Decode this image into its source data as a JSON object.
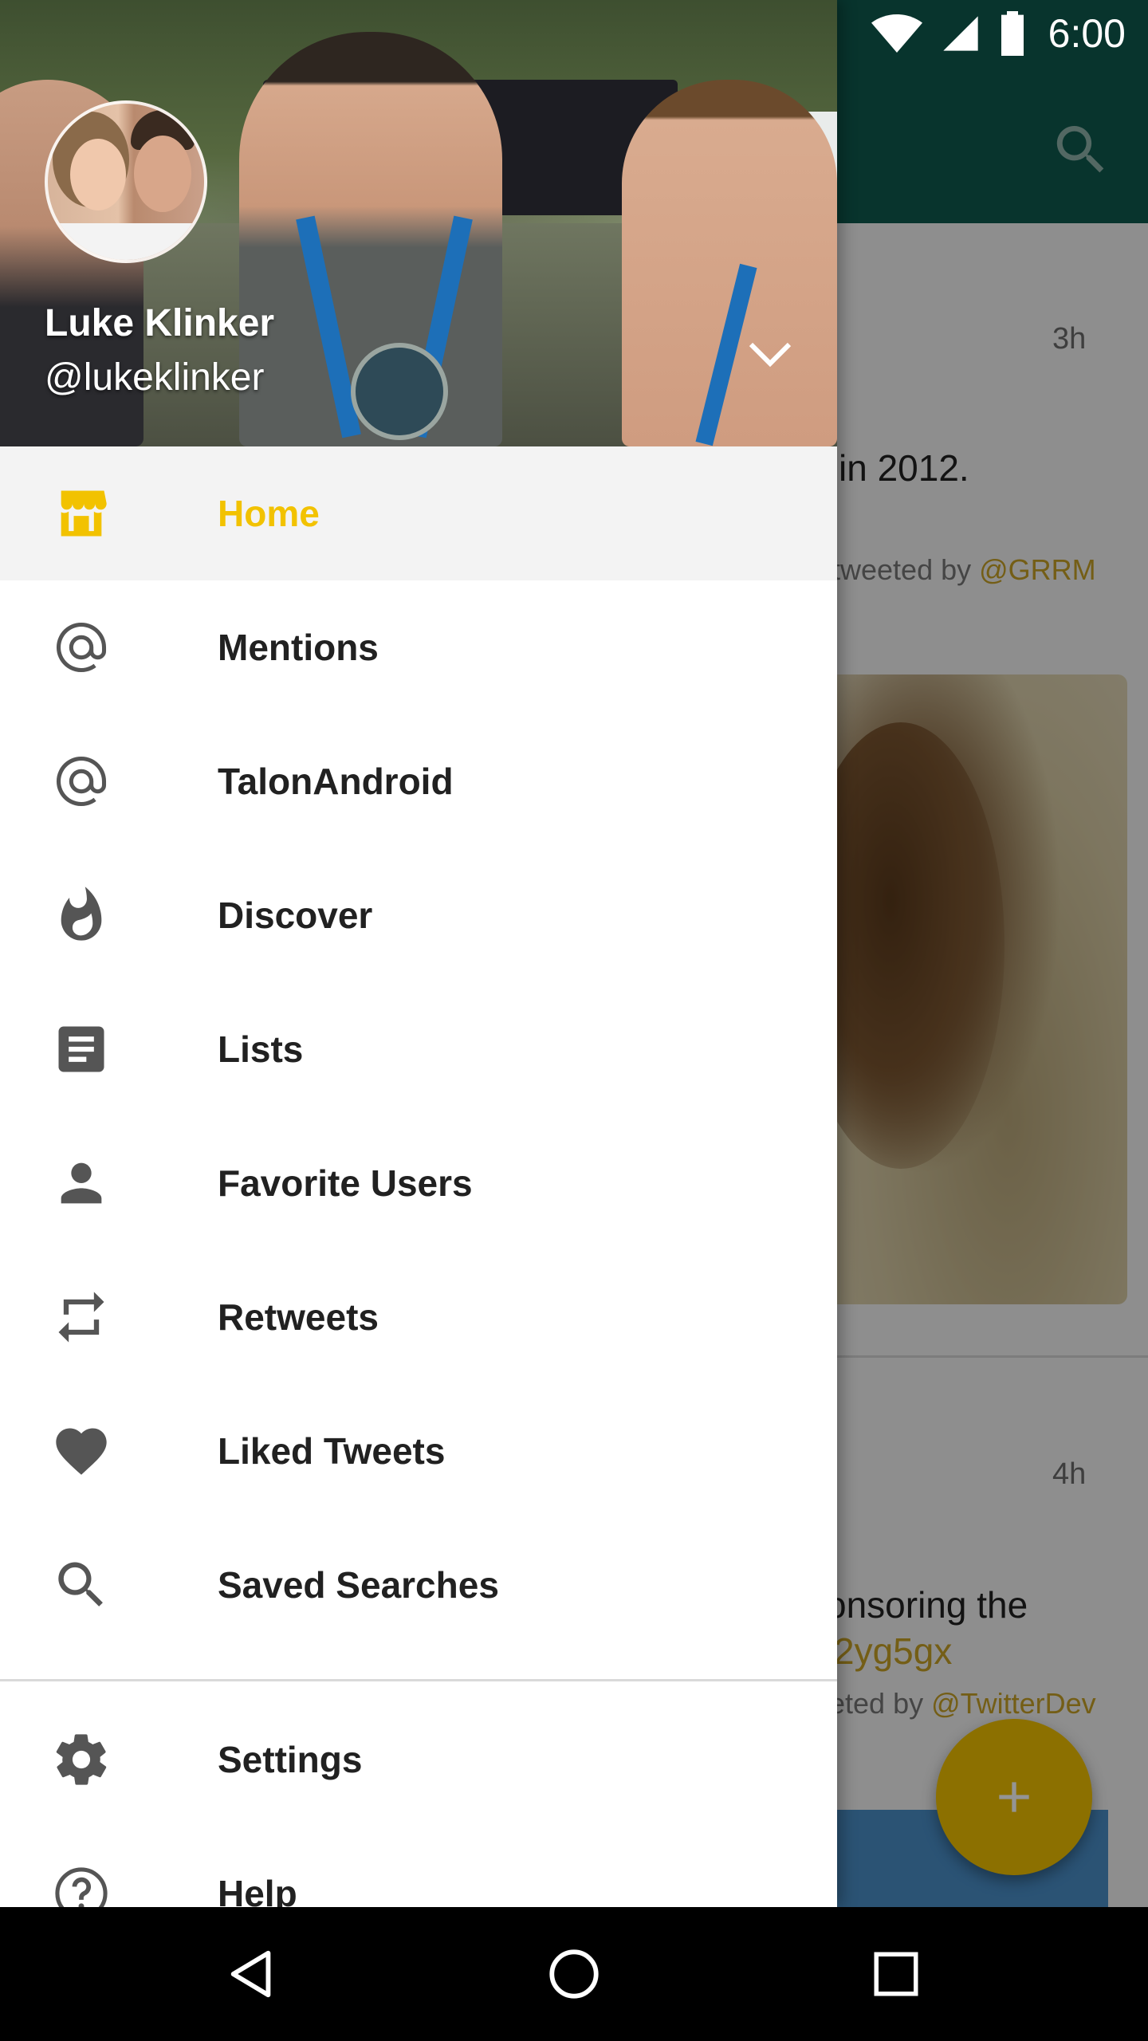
{
  "status_bar": {
    "time": "6:00"
  },
  "app_bar": {
    "search_icon": "search-icon"
  },
  "feed": {
    "tweets": [
      {
        "time": "3h",
        "text": "in 2012.",
        "retweet_prefix": "tweeted by ",
        "retweet_handle": "@GRRM"
      },
      {
        "time": "4h",
        "text_line1": "onsoring the",
        "text_line2": "2yg5gx",
        "retweet_prefix": "eted by ",
        "retweet_handle": "@TwitterDev"
      }
    ],
    "fab_icon": "plus-icon"
  },
  "drawer": {
    "profile": {
      "name": "Luke Klinker",
      "handle": "@lukeklinker",
      "chevron_icon": "chevron-down-icon"
    },
    "items": [
      {
        "label": "Home",
        "icon": "home-icon",
        "active": true
      },
      {
        "label": "Mentions",
        "icon": "at-icon"
      },
      {
        "label": "TalonAndroid",
        "icon": "at-icon"
      },
      {
        "label": "Discover",
        "icon": "flame-icon"
      },
      {
        "label": "Lists",
        "icon": "list-icon"
      },
      {
        "label": "Favorite Users",
        "icon": "person-icon"
      },
      {
        "label": "Retweets",
        "icon": "retweet-icon"
      },
      {
        "label": "Liked Tweets",
        "icon": "heart-icon"
      },
      {
        "label": "Saved Searches",
        "icon": "search-icon"
      }
    ],
    "secondary_items": [
      {
        "label": "Settings",
        "icon": "gear-icon"
      },
      {
        "label": "Help",
        "icon": "help-icon"
      }
    ]
  },
  "colors": {
    "accent": "#f2c200",
    "app_bar": "#0e5a4e"
  },
  "system_nav": {
    "back_icon": "back-icon",
    "home_icon": "home-circle-icon",
    "recents_icon": "recents-icon"
  }
}
